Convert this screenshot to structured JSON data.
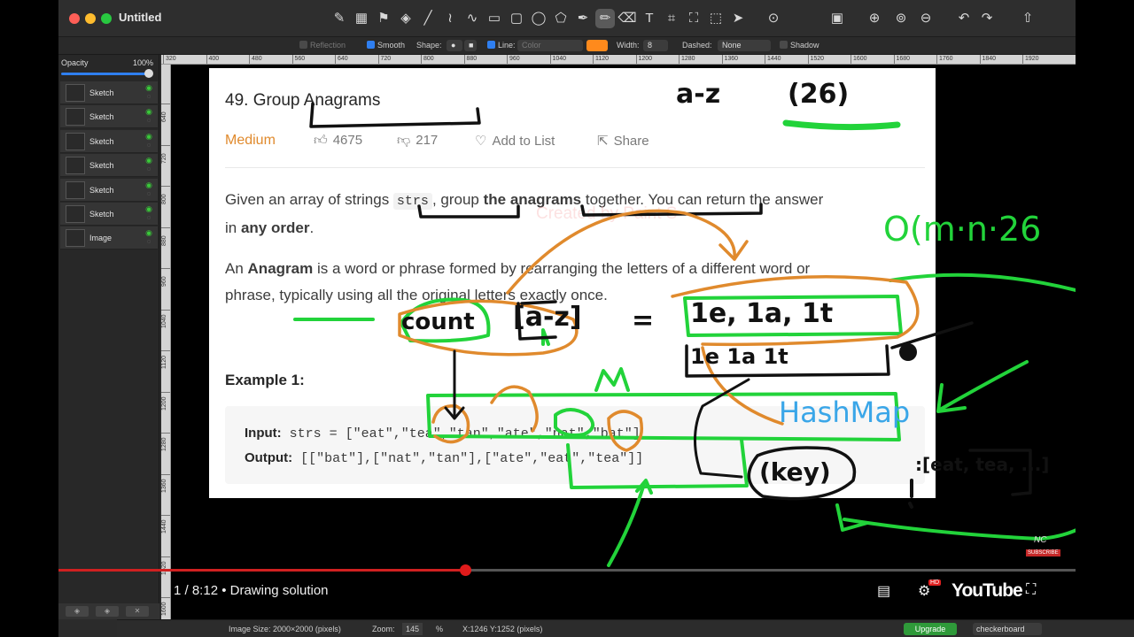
{
  "window": {
    "title": "Untitled"
  },
  "toolbar": {
    "tools": [
      "color-picker-icon",
      "color-swatch-icon",
      "fill-icon",
      "paint-bucket-icon",
      "line-icon",
      "zigzag-icon",
      "curve-icon",
      "rectangle-icon",
      "rounded-rect-icon",
      "ellipse-icon",
      "polygon-icon",
      "pen-icon",
      "pencil-icon",
      "eraser-icon",
      "text-icon",
      "crop-icon",
      "transform-icon",
      "magic-select-icon",
      "pointer-icon"
    ],
    "glyphs": [
      "✎",
      "▦",
      "⚑",
      "◈",
      "╱",
      "≀",
      "∿",
      "▭",
      "▢",
      "◯",
      "⬠",
      "✒",
      "✏",
      "⌫",
      "T",
      "⌗",
      "⛶",
      "⬚",
      "➤"
    ],
    "more": "⊙",
    "zoom_in": "⊕",
    "zoom_fit": "⊚",
    "zoom_out": "⊖",
    "undo": "↶",
    "redo": "↷",
    "share": "⇧"
  },
  "options": {
    "reflection": "Reflection",
    "smooth": "Smooth",
    "shape": "Shape:",
    "line": "Line:",
    "color": "Color",
    "width_label": "Width:",
    "width_value": "8",
    "dashed_label": "Dashed:",
    "dashed_value": "None",
    "shadow": "Shadow"
  },
  "layers_panel": {
    "opacity_label": "Opacity",
    "opacity_value": "100%",
    "layers": [
      {
        "name": "Sketch"
      },
      {
        "name": "Sketch"
      },
      {
        "name": "Sketch"
      },
      {
        "name": "Sketch"
      },
      {
        "name": "Sketch"
      },
      {
        "name": "Sketch"
      },
      {
        "name": "Image"
      }
    ]
  },
  "rulers": {
    "h": [
      "320",
      "400",
      "480",
      "560",
      "640",
      "720",
      "800",
      "880",
      "960",
      "1040",
      "1120",
      "1200",
      "1280",
      "1360",
      "1440",
      "1520",
      "1600",
      "1680",
      "1760",
      "1840",
      "1920"
    ],
    "v": [
      "640",
      "720",
      "800",
      "880",
      "960",
      "1040",
      "1120",
      "1200",
      "1280",
      "1360",
      "1440",
      "1520",
      "1600"
    ]
  },
  "problem": {
    "title": "49. Group Anagrams",
    "difficulty": "Medium",
    "likes": "4675",
    "dislikes": "217",
    "add_to_list": "Add to List",
    "share": "Share",
    "watermark": "Created by Paint S",
    "desc_1a": "Given an array of strings ",
    "desc_code": "strs",
    "desc_1b": ", group ",
    "desc_bold": "the anagrams",
    "desc_1c": " together. You can return the answer",
    "desc_2a": "in ",
    "desc_2b": "any order",
    "desc_2c": ".",
    "def_1a": "An ",
    "def_bold": "Anagram",
    "def_1b": " is a word or phrase formed by rearranging the letters of a different word or",
    "def_2": "phrase, typically using all the original letters exactly once.",
    "example_title": "Example 1:",
    "input_label": "Input:",
    "input_value": "strs = [\"eat\",\"tea\",\"tan\",\"ate\",\"nat\",\"bat\"]",
    "output_label": "Output:",
    "output_value": "[[\"bat\"],[\"nat\",\"tan\"],[\"ate\",\"eat\",\"tea\"]]"
  },
  "handwriting": {
    "az": "a-z",
    "az26": "(26)",
    "complexity": "O(m·n·26",
    "count": "count",
    "az_bracket": "[a-z]",
    "equals": "=",
    "counts_top": "1e, 1a, 1t",
    "counts_bottom": "1e   1a   1t",
    "m": "m",
    "hashmap": "HashMap",
    "key": "(key)",
    "colon_list": ":[eat, tea, ...]"
  },
  "player": {
    "time": "1 / 8:12 • Drawing solution",
    "logo": "YouTube",
    "channel_mark": "NC",
    "subscribe": "SUBSCRIBE",
    "hd": "HD",
    "captions_icon": "▤",
    "settings_icon": "⚙",
    "fullscreen_icon": "⛶",
    "played_fraction": 0.4
  },
  "status": {
    "image_size": "Image Size: 2000×2000 (pixels)",
    "zoom_label": "Zoom:",
    "zoom_value": "145",
    "zoom_unit": "%",
    "cursor": "X:1246 Y:1252 (pixels)",
    "upgrade": "Upgrade",
    "background": "checkerboard"
  },
  "colors": {
    "ink_green": "#22d33a",
    "ink_orange": "#e08a2d",
    "ink_black": "#111111",
    "hashmap_blue": "#3aa6e8",
    "accent": "#2f7ff0"
  }
}
